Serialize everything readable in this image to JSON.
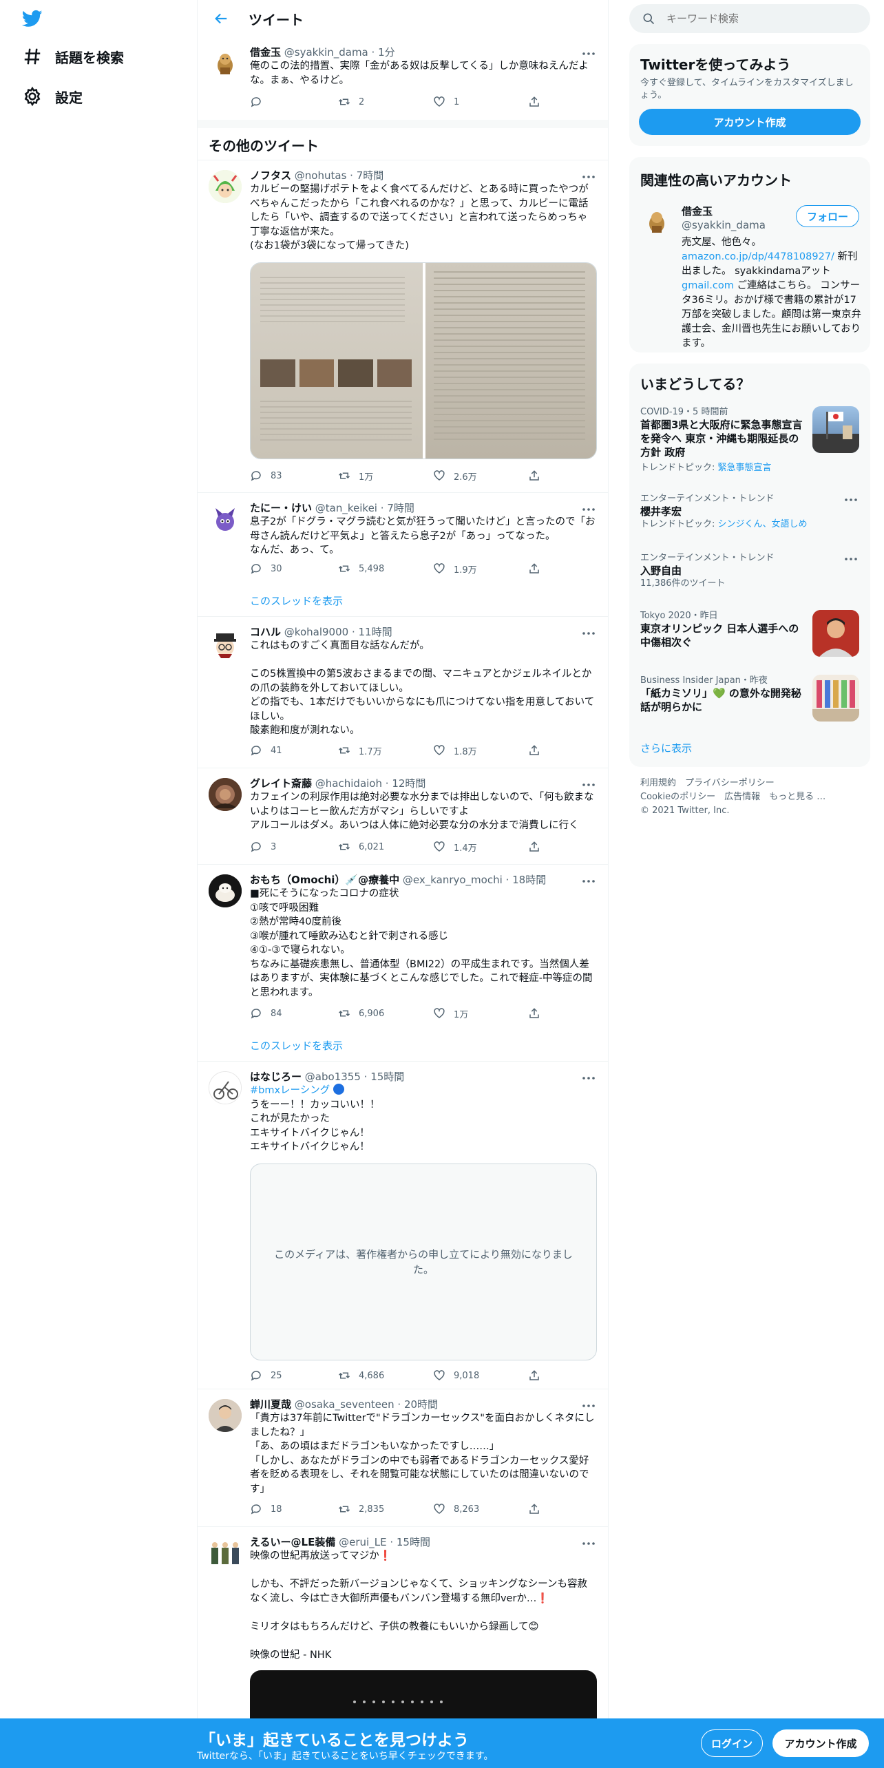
{
  "nav": {
    "explore_label": "話題を検索",
    "settings_label": "設定"
  },
  "header": {
    "title": "ツイート"
  },
  "main_tweet": {
    "name": "借金玉",
    "handle": "@syakkin_dama",
    "time": "1分",
    "text": "俺のこの法的措置、実際「金がある奴は反撃してくる」しか意味ねえんだよな。まぁ、やるけど。",
    "replies": "",
    "retweets": "2",
    "likes": "1"
  },
  "other_tweets_title": "その他のツイート",
  "tweets": [
    {
      "name": "ノフタス",
      "handle": "@nohutas",
      "time": "7時間",
      "text": "カルビーの堅揚げポテトをよく食べてるんだけど、とある時に買ったやつがべちゃんこだったから「これ食べれるのかな？」と思って、カルビーに電話したら「いや、調査するので送ってください」と言われて送ったらめっちゃ丁寧な返信が来た。\n(なお1袋が3袋になって帰ってきた)",
      "replies": "83",
      "retweets": "1万",
      "likes": "2.6万"
    },
    {
      "name": "たにー・けい",
      "handle": "@tan_keikei",
      "time": "7時間",
      "text": "息子2が「ドグラ・マグラ読むと気が狂うって聞いたけど」と言ったので「お母さん読んだけど平気よ」と答えたら息子2が「あっ」ってなった。\nなんだ、あっ、て。",
      "replies": "30",
      "retweets": "5,498",
      "likes": "1.9万",
      "show_thread": "このスレッドを表示"
    },
    {
      "name": "コハル",
      "handle": "@kohal9000",
      "time": "11時間",
      "text": "これはものすごく真面目な話なんだが。\n\nこの5株置換中の第5波おさまるまでの間、マニキュアとかジェルネイルとかの爪の装飾を外しておいてほしい。\nどの指でも、1本だけでもいいからなにも爪につけてない指を用意しておいてほしい。\n酸素飽和度が測れない。",
      "replies": "41",
      "retweets": "1.7万",
      "likes": "1.8万"
    },
    {
      "name": "グレイト斎藤",
      "handle": "@hachidaioh",
      "time": "12時間",
      "text": "カフェインの利尿作用は絶対必要な水分までは排出しないので、「何も飲まないよりはコーヒー飲んだ方がマシ」らしいですよ\nアルコールはダメ。あいつは人体に絶対必要な分の水分まで消費しに行く",
      "replies": "3",
      "retweets": "6,021",
      "likes": "1.4万"
    },
    {
      "name": "おもち（Omochi）💉@療養中",
      "handle": "@ex_kanryo_mochi",
      "time": "18時間",
      "text": "■死にそうになったコロナの症状\n①咳で呼吸困難\n②熱が常時40度前後\n③喉が腫れて唾飲み込むと針で刺される感じ\n④①-③で寝られない。\nちなみに基礎疾患無し、普通体型（BMI22）の平成生まれです。当然個人差はありますが、実体験に基づくとこんな感じでした。これで軽症-中等症の間と思われます。",
      "replies": "84",
      "retweets": "6,906",
      "likes": "1万",
      "show_thread": "このスレッドを表示"
    },
    {
      "name": "はなじろー",
      "handle": "@abo1355",
      "time": "15時間",
      "hashtag": "#bmxレーシング",
      "text": "うをーー！！カッコいい！！\nこれが見たかった\nエキサイトバイクじゃん！\nエキサイトバイクじゃん！",
      "media_notice": "このメディアは、著作権者からの申し立てにより無効になりました。",
      "replies": "25",
      "retweets": "4,686",
      "likes": "9,018"
    },
    {
      "name": "蝉川夏哉",
      "handle": "@osaka_seventeen",
      "time": "20時間",
      "text": "「貴方は37年前にTwitterで\"ドラゴンカーセックス\"を面白おかしくネタにしましたね？」\n「あ、あの頃はまだドラゴンもいなかったですし……」\n「しかし、あなたがドラゴンの中でも弱者であるドラゴンカーセックス愛好者を貶める表現をし、それを閲覧可能な状態にしていたのは間違いないのです」",
      "replies": "18",
      "retweets": "2,835",
      "likes": "8,263"
    },
    {
      "name": "えるいー@LE装備",
      "handle": "@erui_LE",
      "time": "15時間",
      "text": "映像の世紀再放送ってマジか❗\n\nしかも、不評だった新バージョンじゃなくて、ショッキングなシーンも容赦なく流し、今は亡き大御所声優もバンバン登場する無印verか…❗\n\nミリオタはもちろんだけど、子供の教養にもいいから録画して😊\n\n映像の世紀 - NHK"
    }
  ],
  "sidebar": {
    "search_placeholder": "キーワード検索",
    "signup_card": {
      "title": "Twitterを使ってみよう",
      "desc": "今すぐ登録して、タイムラインをカスタマイズしましょう。",
      "button": "アカウント作成"
    },
    "relevant": {
      "title": "関連性の高いアカウント",
      "name": "借金玉",
      "handle": "@syakkin_dama",
      "follow": "フォロー",
      "bio_1": "売文屋、他色々。",
      "bio_link": "amazon.co.jp/dp/4478108927/",
      "bio_2": "新刊出ました。 syakkindamaアット",
      "bio_link2": "gmail.com",
      "bio_3": "ご連絡はこちら。 コンサータ36ミリ。おかげ様で書籍の累計が17万部を突破しました。顧問は第一東京弁護士会、金川晋也先生にお願いしております。"
    },
    "trends": {
      "title": "いまどうしてる？",
      "items": [
        {
          "meta": "COVID-19・5 時間前",
          "title": "首都圏3県と大阪府に緊急事態宣言を発令へ 東京・沖縄も期限延長の方針 政府",
          "sub_prefix": "トレンドトピック: ",
          "sub_link": "緊急事態宣言"
        },
        {
          "meta": "エンターテインメント・トレンド",
          "title": "櫻井孝宏",
          "sub_prefix": "トレンドトピック: ",
          "sub_link": "シンジくん、女語しめ"
        },
        {
          "meta": "エンターテインメント・トレンド",
          "title": "入野自由",
          "sub": "11,386件のツイート"
        },
        {
          "meta": "Tokyo 2020・昨日",
          "title": "東京オリンピック 日本人選手への中傷相次ぐ"
        },
        {
          "meta": "Business Insider Japan・昨夜",
          "title": "「紙カミソリ」💚 の意外な開発秘話が明らかに"
        }
      ],
      "show_more": "さらに表示"
    },
    "footer": {
      "line1": "利用規約　プライバシーポリシー",
      "line2": "Cookieのポリシー　広告情報　もっと見る …",
      "line3": "© 2021 Twitter, Inc."
    }
  },
  "bottombar": {
    "headline": "「いま」起きていることを見つけよう",
    "sub": "Twitterなら、「いま」起きていることをいち早くチェックできます。",
    "login": "ログイン",
    "signup": "アカウント作成"
  },
  "colors": {
    "accent": "#1d9bf0",
    "text": "#0f1419",
    "muted": "#536471"
  }
}
